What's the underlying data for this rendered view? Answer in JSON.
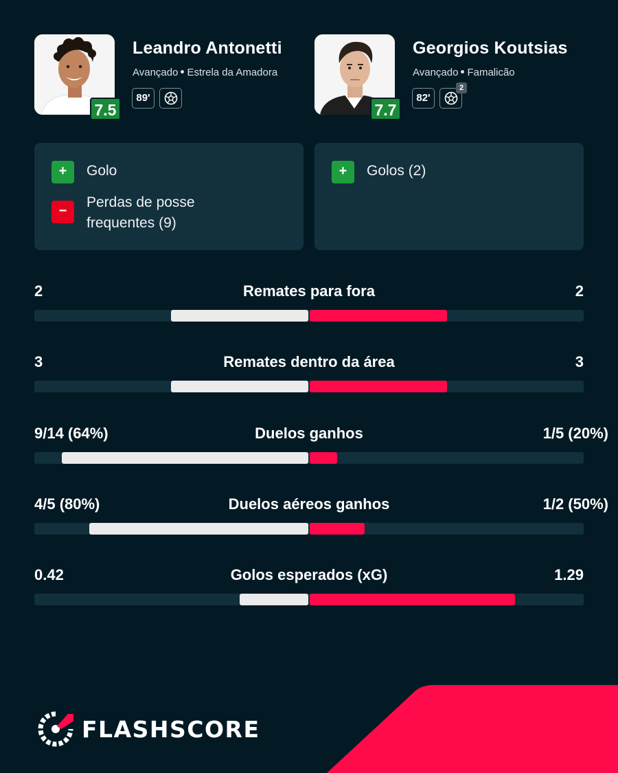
{
  "players": [
    {
      "name": "Leandro Antonetti",
      "position": "Avançado",
      "team": "Estrela da Amadora",
      "rating": "7.5",
      "minute": "89'",
      "goals_badge": ""
    },
    {
      "name": "Georgios Koutsias",
      "position": "Avançado",
      "team": "Famalicão",
      "rating": "7.7",
      "minute": "82'",
      "goals_badge": "2"
    }
  ],
  "highlights": {
    "left": [
      {
        "sign": "+",
        "type": "positive",
        "text": "Golo"
      },
      {
        "sign": "−",
        "type": "negative",
        "text": "Perdas de posse frequentes (9)"
      }
    ],
    "right": [
      {
        "sign": "+",
        "type": "positive",
        "text": "Golos (2)"
      }
    ]
  },
  "stats": [
    {
      "label": "Remates para fora",
      "left": "2",
      "right": "2",
      "left_share": 0.5,
      "right_share": 0.5
    },
    {
      "label": "Remates dentro da área",
      "left": "3",
      "right": "3",
      "left_share": 0.5,
      "right_share": 0.5
    },
    {
      "label": "Duelos ganhos",
      "left": "9/14 (64%)",
      "right": "1/5 (20%)",
      "left_share": 0.9,
      "right_share": 0.1
    },
    {
      "label": "Duelos aéreos ganhos",
      "left": "4/5 (80%)",
      "right": "1/2 (50%)",
      "left_share": 0.8,
      "right_share": 0.2
    },
    {
      "label": "Golos esperados (xG)",
      "left": "0.42",
      "right": "1.29",
      "left_share": 0.25,
      "right_share": 0.75
    }
  ],
  "brand": {
    "name": "FLASHSCORE",
    "accent": "#ff0a4a",
    "background": "#031a25",
    "positive": "#1e9e3e",
    "negative": "#e8001e"
  },
  "icons": {
    "ball": "football-icon",
    "logo": "flashscore-logo-icon"
  }
}
